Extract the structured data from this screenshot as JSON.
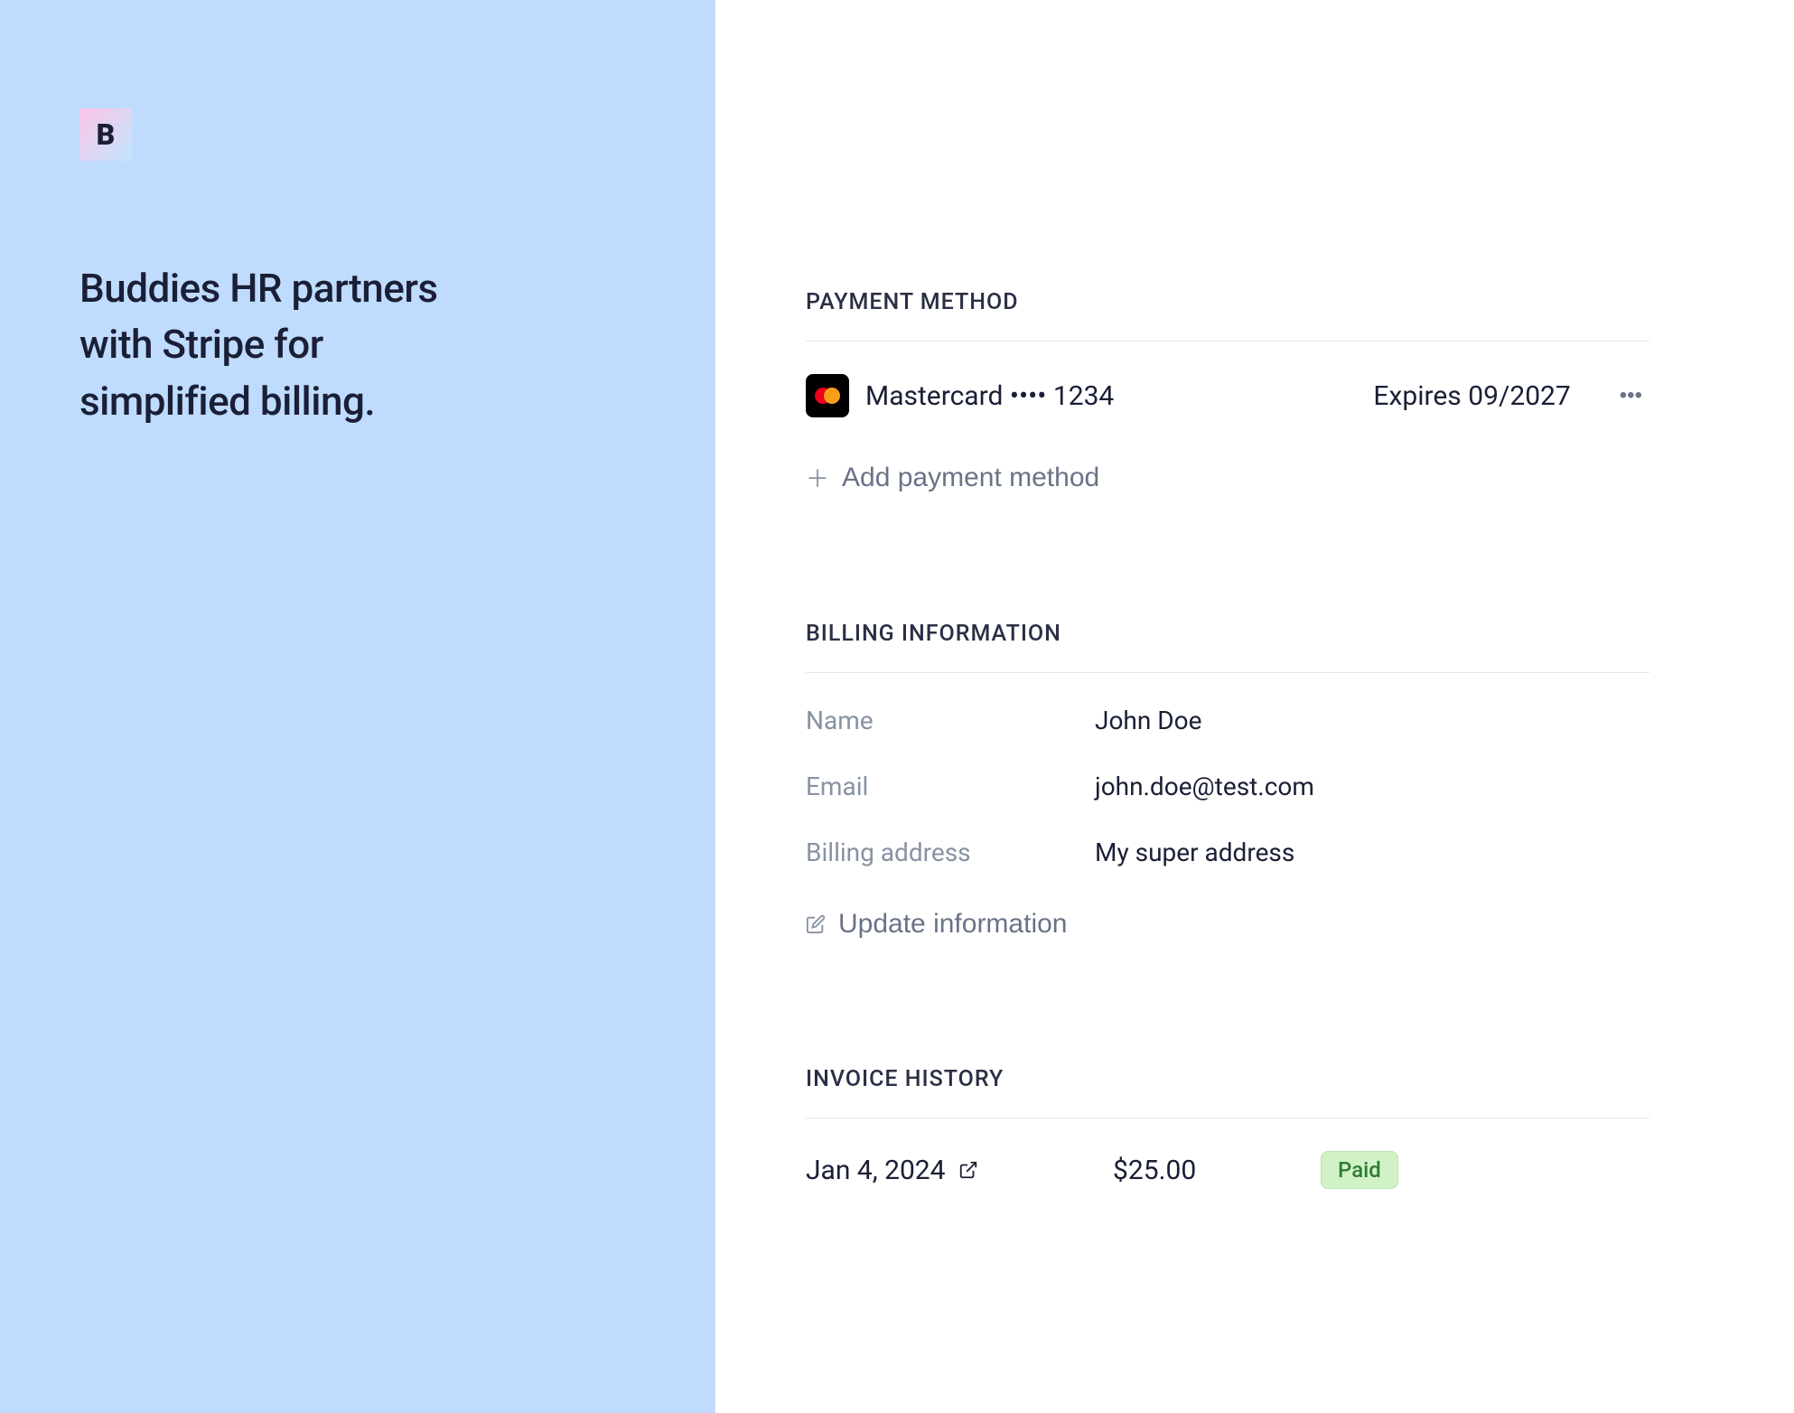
{
  "sidebar": {
    "logo_letter": "B",
    "heading": "Buddies HR partners with Stripe for simplified billing."
  },
  "payment_method": {
    "title": "PAYMENT METHOD",
    "card": {
      "brand": "Mastercard",
      "dots": "••••",
      "last4": "1234",
      "expires_label": "Expires",
      "expires": "09/2027"
    },
    "add_label": "Add payment method"
  },
  "billing_info": {
    "title": "BILLING INFORMATION",
    "fields": {
      "name_label": "Name",
      "name_value": "John Doe",
      "email_label": "Email",
      "email_value": "john.doe@test.com",
      "address_label": "Billing address",
      "address_value": "My super address"
    },
    "update_label": "Update information"
  },
  "invoice_history": {
    "title": "INVOICE HISTORY",
    "invoices": [
      {
        "date": "Jan 4, 2024",
        "amount": "$25.00",
        "status": "Paid"
      }
    ]
  }
}
